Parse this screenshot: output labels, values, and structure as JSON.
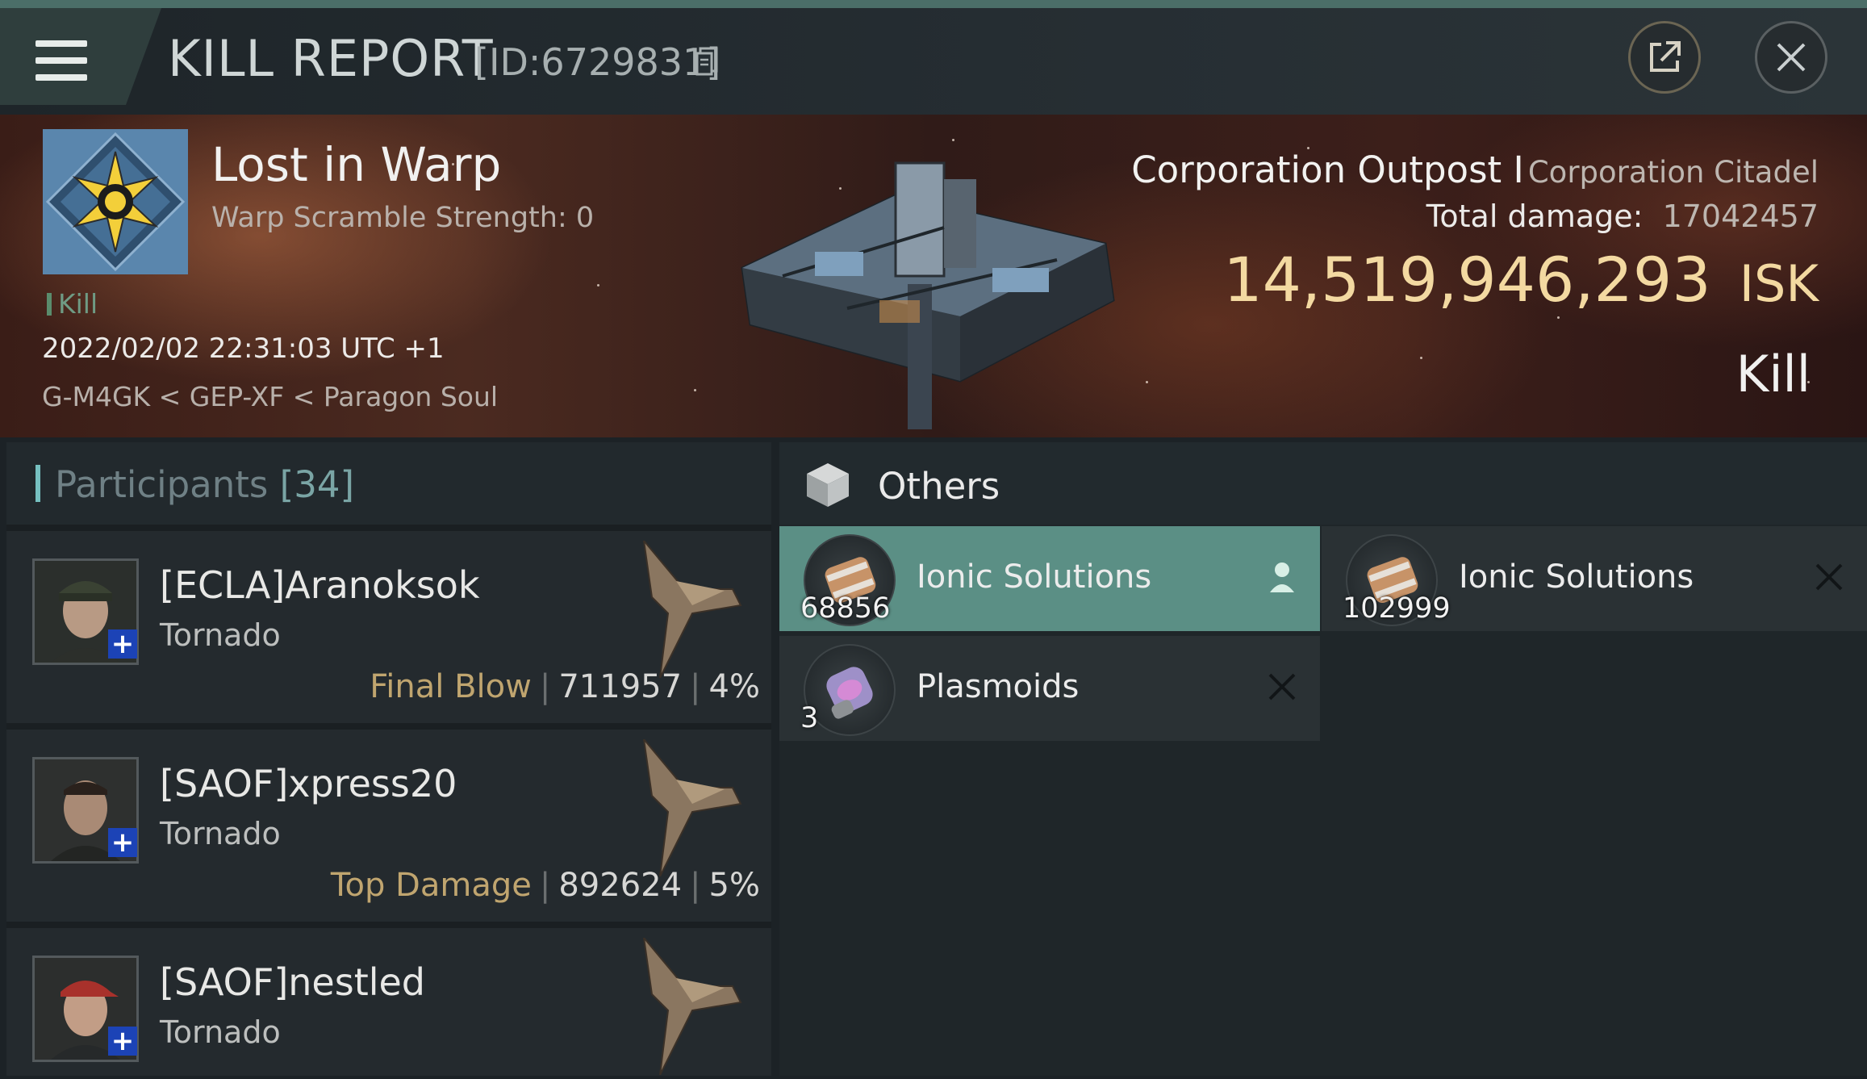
{
  "window": {
    "title": "KILL REPORT",
    "report_id": "[ID:6729831]"
  },
  "victim": {
    "name": "Lost in Warp",
    "warp_scramble": "Warp Scramble Strength: 0",
    "kill_tag": "Kill",
    "datetime": "2022/02/02 22:31:03 UTC +1",
    "location": "G-M4GK < GEP-XF < Paragon Soul",
    "ship_name": "Corporation Outpost I",
    "ship_class": "Corporation Citadel",
    "total_damage_label": "Total damage:",
    "total_damage": "17042457",
    "isk_value": "14,519,946,293",
    "isk_unit": "ISK",
    "result": "Kill"
  },
  "participants": {
    "label": "Participants",
    "count": "[34]",
    "items": [
      {
        "name": "[ECLA]Aranoksok",
        "ship": "Tornado",
        "tag": "Final Blow",
        "damage": "711957",
        "percent": "4%"
      },
      {
        "name": "[SAOF]xpress20",
        "ship": "Tornado",
        "tag": "Top Damage",
        "damage": "892624",
        "percent": "5%"
      },
      {
        "name": "[SAOF]nestled",
        "ship": "Tornado"
      }
    ]
  },
  "others": {
    "label": "Others",
    "items": [
      {
        "name": "Ionic Solutions",
        "qty": "68856",
        "status": "dropped"
      },
      {
        "name": "Ionic Solutions",
        "qty": "102999",
        "status": "destroyed"
      },
      {
        "name": "Plasmoids",
        "qty": "3",
        "status": "destroyed"
      }
    ]
  },
  "colors": {
    "accent_teal": "#5b8f85",
    "isk_gold": "#f3d9a1",
    "tag_gold": "#c0a56f"
  },
  "icons": {
    "menu": "hamburger-icon",
    "copy": "copy-icon",
    "share": "external-link-icon",
    "close": "close-icon",
    "others": "cube-icon",
    "dropped": "person-icon",
    "destroyed": "x-icon"
  }
}
